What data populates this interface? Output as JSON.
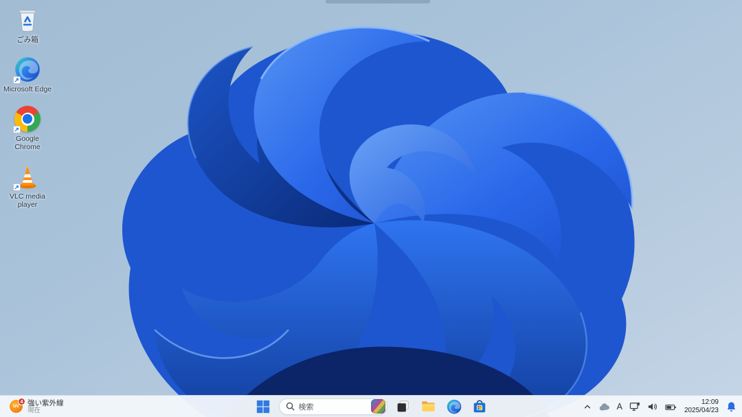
{
  "wallpaper": {
    "name": "windows-11-bloom",
    "background_top": "#a2bcd4",
    "background_bottom": "#c4d5e6",
    "bloom_blue": "#2563e3"
  },
  "desktop": {
    "icons": [
      {
        "id": "recycle-bin",
        "label": "ごみ箱"
      },
      {
        "id": "microsoft-edge",
        "label": "Microsoft Edge"
      },
      {
        "id": "google-chrome",
        "label": "Google Chrome"
      },
      {
        "id": "vlc-media-player",
        "label": "VLC media player"
      }
    ]
  },
  "taskbar": {
    "widget": {
      "icon": "uv-index-icon",
      "icon_label": "UV",
      "badge": "4",
      "title": "強い紫外線",
      "subtitle": "現在"
    },
    "search": {
      "placeholder": "検索"
    },
    "apps": [
      {
        "id": "start-button"
      },
      {
        "id": "search-box"
      },
      {
        "id": "task-view"
      },
      {
        "id": "file-explorer"
      },
      {
        "id": "microsoft-edge"
      },
      {
        "id": "microsoft-store"
      }
    ],
    "tray": {
      "hidden_icons": "chevron-up",
      "onedrive": "cloud-icon",
      "ime": "A",
      "network": "ethernet-icon",
      "volume": "speaker-icon",
      "power": "battery-icon",
      "time": "12:09",
      "date": "2025/04/23",
      "notifications": "bell-icon"
    },
    "colors": {
      "bar": "#f3f7fb",
      "start_blue": "#2f7be0",
      "bell_blue": "#2b6be4"
    }
  }
}
